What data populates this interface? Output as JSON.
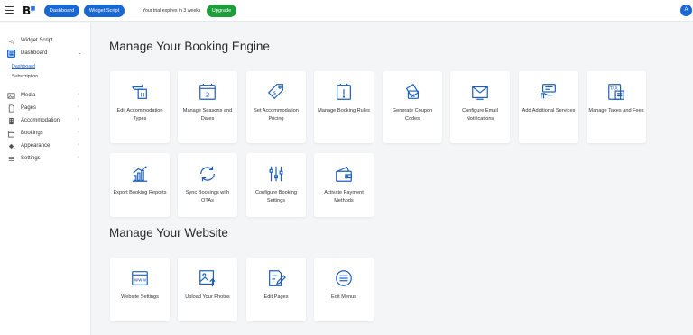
{
  "topbar": {
    "logo": "B",
    "dashboard_btn": "Dashboard",
    "widget_btn": "Widget Script",
    "trial_text": "Your trial expires in 3 weeks",
    "upgrade_btn": "Upgrade",
    "avatar_initial": "A"
  },
  "sidebar": {
    "widget_script": "Widget Script",
    "dashboard": "Dashboard",
    "sub_dashboard": "Dashboard",
    "sub_subscription": "Subscription",
    "media": "Media",
    "pages": "Pages",
    "accommodation": "Accommodation",
    "bookings": "Bookings",
    "appearance": "Appearance",
    "settings": "Settings"
  },
  "booking": {
    "title": "Manage Your Booking Engine",
    "cards": [
      {
        "label": "Edit Accommodation Types",
        "icon": "hotel-sign-icon"
      },
      {
        "label": "Manage Seasons and Dates",
        "icon": "calendar-icon"
      },
      {
        "label": "Set Accommodation Pricing",
        "icon": "price-tag-icon"
      },
      {
        "label": "Manage Booking Rules",
        "icon": "rules-calendar-icon"
      },
      {
        "label": "Generate Coupon Codes",
        "icon": "coupon-icon"
      },
      {
        "label": "Configure Email Notifications",
        "icon": "email-icon"
      },
      {
        "label": "Add Additional Services",
        "icon": "service-hand-icon"
      },
      {
        "label": "Manage Taxes and Fees",
        "icon": "tax-icon"
      },
      {
        "label": "Export Booking Reports",
        "icon": "bar-chart-icon"
      },
      {
        "label": "Sync Bookings with OTAs",
        "icon": "sync-icon"
      },
      {
        "label": "Configure Booking Settings",
        "icon": "sliders-icon"
      },
      {
        "label": "Activate Payment Methods",
        "icon": "wallet-icon"
      }
    ]
  },
  "website": {
    "title": "Manage Your Website",
    "cards": [
      {
        "label": "Website Settings",
        "icon": "browser-icon"
      },
      {
        "label": "Upload Your Photos",
        "icon": "photo-upload-icon"
      },
      {
        "label": "Edit Pages",
        "icon": "edit-page-icon"
      },
      {
        "label": "Edit Menus",
        "icon": "menu-icon"
      }
    ]
  },
  "colors": {
    "accent": "#1967d2",
    "upgrade": "#1e9e3a",
    "icon": "#1f5fb8"
  }
}
